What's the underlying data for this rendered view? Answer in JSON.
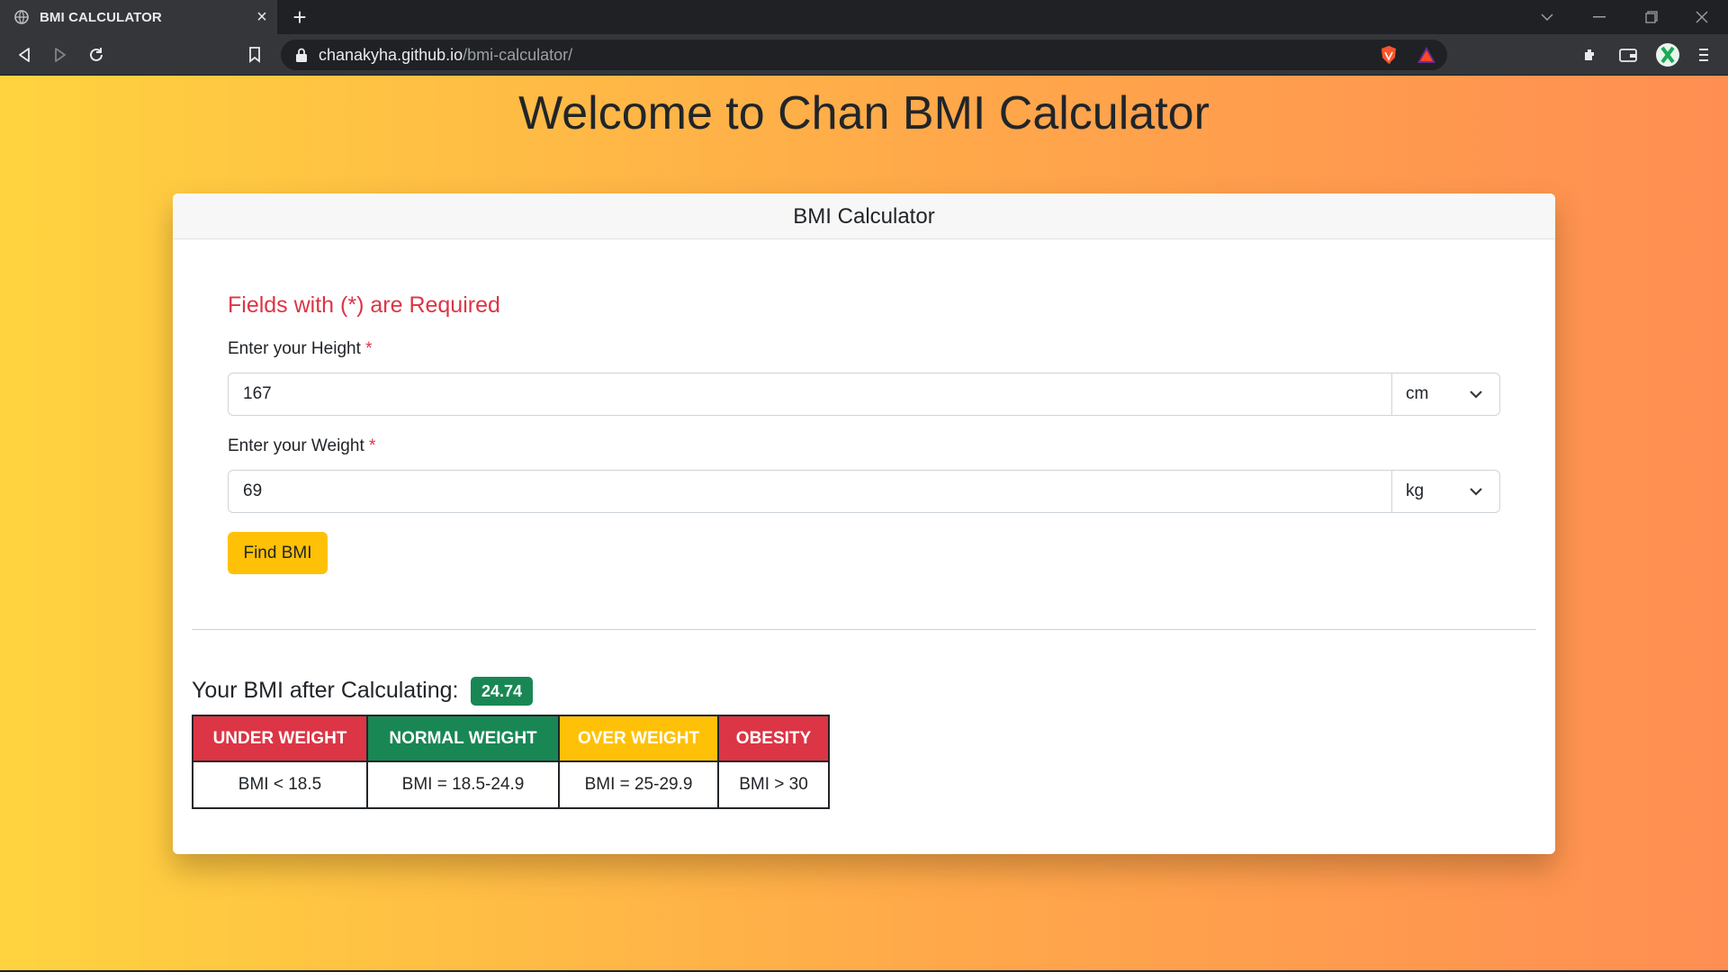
{
  "browser": {
    "tab_title": "BMI CALCULATOR",
    "tab_close": "×",
    "new_tab": "+",
    "url_domain": "chanakyha.github.io",
    "url_path": "/bmi-calculator/"
  },
  "page": {
    "heading": "Welcome to Chan BMI Calculator",
    "card_title": "BMI Calculator",
    "required_note": "Fields with (*) are Required",
    "height": {
      "label": "Enter your Height",
      "required_mark": "*",
      "value": "167",
      "unit": "cm"
    },
    "weight": {
      "label": "Enter your Weight",
      "required_mark": "*",
      "value": "69",
      "unit": "kg"
    },
    "find_button": "Find BMI",
    "result_label": "Your BMI after Calculating:",
    "bmi_value": "24.74",
    "categories": [
      {
        "name": "UNDER WEIGHT",
        "range": "BMI < 18.5",
        "color": "#dc3545"
      },
      {
        "name": "NORMAL WEIGHT",
        "range": "BMI = 18.5-24.9",
        "color": "#198754"
      },
      {
        "name": "OVER WEIGHT",
        "range": "BMI = 25-29.9",
        "color": "#ffc107"
      },
      {
        "name": "OBESITY",
        "range": "BMI > 30",
        "color": "#dc3545"
      }
    ]
  },
  "colors": {
    "accent_required": "#dc3545",
    "button": "#ffc107",
    "badge": "#198754",
    "background_gradient": [
      "#ffd33f",
      "#ff8e52"
    ]
  },
  "icons": [
    "globe-icon",
    "back-icon",
    "forward-icon",
    "reload-icon",
    "bookmark-icon",
    "lock-icon",
    "brave-shield-icon",
    "brave-rewards-icon",
    "extensions-icon",
    "wallet-icon",
    "profile-icon",
    "menu-icon",
    "chevron-down-icon"
  ]
}
